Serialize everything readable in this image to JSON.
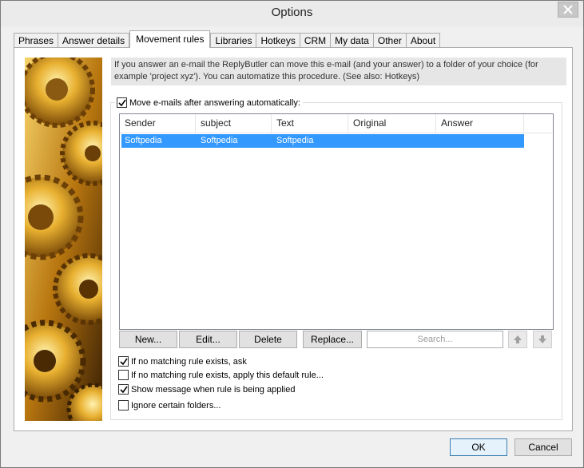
{
  "window": {
    "title": "Options"
  },
  "tabs": [
    {
      "label": "Phrases"
    },
    {
      "label": "Answer details"
    },
    {
      "label": "Movement rules"
    },
    {
      "label": "Libraries"
    },
    {
      "label": "Hotkeys"
    },
    {
      "label": "CRM"
    },
    {
      "label": "My data"
    },
    {
      "label": "Other"
    },
    {
      "label": "About"
    }
  ],
  "active_tab": "Movement rules",
  "info": {
    "text": "If you answer an e-mail the ReplyButler can move this e-mail (and your answer) to a folder of your choice (for example 'project xyz'). You can automatize this procedure. (See also: Hotkeys)"
  },
  "move_automatically": {
    "label": "Move e-mails after answering automatically:",
    "checked": true
  },
  "rules_table": {
    "columns": [
      "Sender",
      "subject",
      "Text",
      "Original",
      "Answer"
    ],
    "rows": [
      {
        "sender": "Softpedia",
        "subject": "Softpedia",
        "text": "Softpedia",
        "original": "",
        "answer": ""
      }
    ]
  },
  "buttons": {
    "new": "New...",
    "edit": "Edit...",
    "delete": "Delete",
    "replace": "Replace..."
  },
  "search": {
    "placeholder": "Search..."
  },
  "options": [
    {
      "label": "If no matching rule exists, ask",
      "checked": true
    },
    {
      "label": "If no matching rule exists, apply this default rule...",
      "checked": false
    },
    {
      "label": "Show message when rule is being applied",
      "checked": true
    },
    {
      "label": "Ignore certain folders...",
      "checked": false
    }
  ],
  "footer": {
    "ok": "OK",
    "cancel": "Cancel"
  },
  "colors": {
    "selection": "#3399ff",
    "accent": "#3c7fb1"
  }
}
